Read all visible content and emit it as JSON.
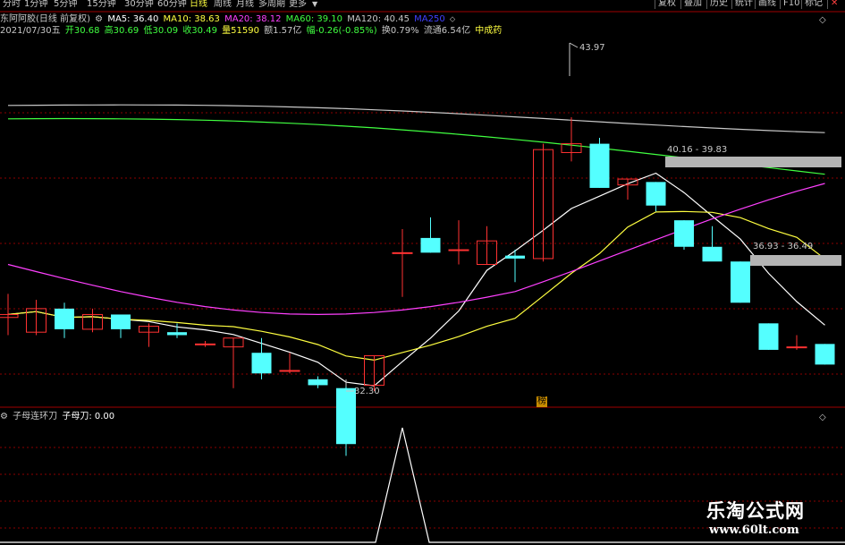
{
  "toolbar": {
    "periods": [
      "分时",
      "1分钟",
      "5分钟",
      "15分钟",
      "30分钟",
      "60分钟",
      "日线",
      "周线",
      "月线",
      "多周期",
      "更多"
    ],
    "active_period": "日线",
    "right_buttons": [
      "复权",
      "叠加",
      "历史",
      "统计",
      "画线",
      "F10",
      "标记"
    ]
  },
  "title": {
    "stock": "东阿阿胶(日线 前复权)",
    "ma": [
      {
        "label": "MA5: 36.40",
        "color": "#ffffff"
      },
      {
        "label": "MA10: 38.63",
        "color": "#ffff40"
      },
      {
        "label": "MA20: 38.12",
        "color": "#ff40ff"
      },
      {
        "label": "MA60: 39.10",
        "color": "#40ff40"
      },
      {
        "label": "MA120: 40.45",
        "color": "#c8c8c8"
      },
      {
        "label": "MA250",
        "color": "#4040ff"
      }
    ]
  },
  "quote": {
    "date": "2021/07/30五",
    "open": "开30.68",
    "high": "高30.69",
    "low": "低30.09",
    "close": "收30.49",
    "volume": "量51590",
    "amount": "额1.57亿",
    "change": "幅-0.26(-0.85%)",
    "turnover": "换0.79%",
    "float": "流通6.54亿",
    "sector": "中成药"
  },
  "annotations": {
    "high_price": "43.97",
    "low_price": "32.30",
    "box1": "40.16 - 39.83",
    "box2": "36.93 - 36.49",
    "rank_badge": "榜"
  },
  "indicator": {
    "name": "子母连环刀",
    "value_label": "子母刀: 0.00"
  },
  "watermark": {
    "line1": "乐淘公式网",
    "line2": "www.60lt.com"
  },
  "colors": {
    "up": "#ff3232",
    "down": "#54ffff",
    "grid": "#8c0000",
    "ma5": "#ffffff",
    "ma10": "#ffff40",
    "ma20": "#ff40ff",
    "ma60": "#40ff40",
    "ma120": "#c8c8c8"
  },
  "candles": [
    {
      "o": 34.8,
      "h": 35.6,
      "l": 34.2,
      "c": 34.9
    },
    {
      "o": 34.3,
      "h": 35.4,
      "l": 34.2,
      "c": 35.1
    },
    {
      "o": 35.1,
      "h": 35.3,
      "l": 34.1,
      "c": 34.4
    },
    {
      "o": 34.4,
      "h": 35.1,
      "l": 34.3,
      "c": 34.9
    },
    {
      "o": 34.9,
      "h": 34.9,
      "l": 34.1,
      "c": 34.4
    },
    {
      "o": 34.3,
      "h": 34.6,
      "l": 33.8,
      "c": 34.5
    },
    {
      "o": 34.3,
      "h": 34.6,
      "l": 34.1,
      "c": 34.2
    },
    {
      "o": 33.9,
      "h": 34.0,
      "l": 33.8,
      "c": 33.9
    },
    {
      "o": 33.8,
      "h": 34.1,
      "l": 32.4,
      "c": 34.1
    },
    {
      "o": 33.6,
      "h": 34.1,
      "l": 32.7,
      "c": 32.9
    },
    {
      "o": 33.0,
      "h": 33.6,
      "l": 32.9,
      "c": 33.0
    },
    {
      "o": 32.7,
      "h": 32.8,
      "l": 32.4,
      "c": 32.5
    },
    {
      "o": 32.4,
      "h": 32.6,
      "l": 30.1,
      "c": 30.5
    },
    {
      "o": 32.5,
      "h": 33.5,
      "l": 32.3,
      "c": 33.5
    },
    {
      "o": 37.0,
      "h": 37.8,
      "l": 35.5,
      "c": 37.0
    },
    {
      "o": 37.5,
      "h": 38.2,
      "l": 37.0,
      "c": 37.0
    },
    {
      "o": 37.1,
      "h": 38.1,
      "l": 36.6,
      "c": 37.1
    },
    {
      "o": 36.6,
      "h": 37.9,
      "l": 36.6,
      "c": 37.4
    },
    {
      "o": 36.9,
      "h": 37.1,
      "l": 36.0,
      "c": 36.8
    },
    {
      "o": 36.8,
      "h": 40.7,
      "l": 36.7,
      "c": 40.5
    },
    {
      "o": 40.4,
      "h": 41.6,
      "l": 40.1,
      "c": 40.7
    },
    {
      "o": 40.7,
      "h": 40.9,
      "l": 39.2,
      "c": 39.2
    },
    {
      "o": 39.3,
      "h": 39.5,
      "l": 38.8,
      "c": 39.5
    },
    {
      "o": 39.4,
      "h": 39.4,
      "l": 38.4,
      "c": 38.6
    },
    {
      "o": 38.1,
      "h": 38.1,
      "l": 37.1,
      "c": 37.2
    },
    {
      "o": 37.2,
      "h": 37.9,
      "l": 36.9,
      "c": 36.7
    },
    {
      "o": 36.7,
      "h": 36.7,
      "l": 35.3,
      "c": 35.3
    },
    {
      "o": 34.6,
      "h": 34.6,
      "l": 33.7,
      "c": 33.7
    },
    {
      "o": 33.8,
      "h": 34.2,
      "l": 33.7,
      "c": 33.8
    },
    {
      "o": 33.9,
      "h": 33.9,
      "l": 33.2,
      "c": 33.2
    }
  ]
}
